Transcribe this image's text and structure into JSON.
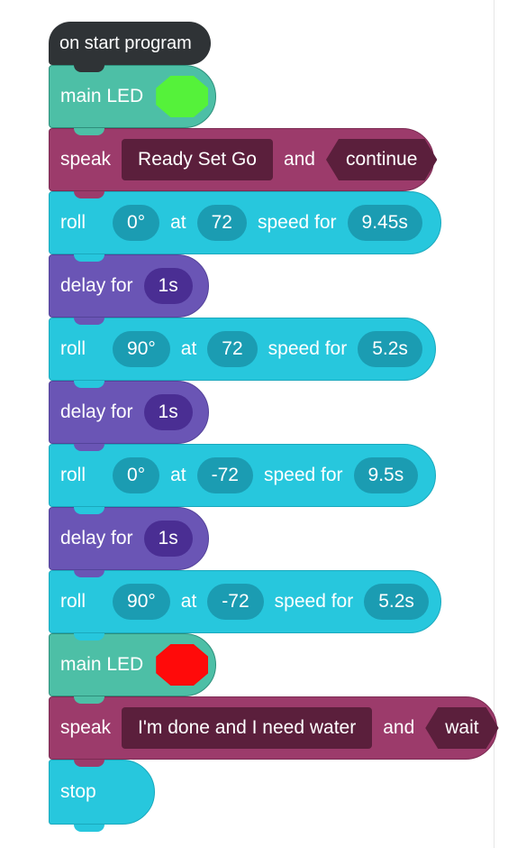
{
  "program": {
    "start_label": "on start program",
    "led1": {
      "label": "main LED",
      "color": "#55f23a"
    },
    "speak1": {
      "label": "speak",
      "text": "Ready Set Go",
      "and_label": "and",
      "mode": "continue"
    },
    "roll1": {
      "label": "roll",
      "heading": "0°",
      "at_label": "at",
      "speed": "72",
      "speed_label": "speed for",
      "duration": "9.45s"
    },
    "delay1": {
      "label": "delay for",
      "duration": "1s"
    },
    "roll2": {
      "label": "roll",
      "heading": "90°",
      "at_label": "at",
      "speed": "72",
      "speed_label": "speed for",
      "duration": "5.2s"
    },
    "delay2": {
      "label": "delay for",
      "duration": "1s"
    },
    "roll3": {
      "label": "roll",
      "heading": "0°",
      "at_label": "at",
      "speed": "-72",
      "speed_label": "speed for",
      "duration": "9.5s"
    },
    "delay3": {
      "label": "delay for",
      "duration": "1s"
    },
    "roll4": {
      "label": "roll",
      "heading": "90°",
      "at_label": "at",
      "speed": "-72",
      "speed_label": "speed for",
      "duration": "5.2s"
    },
    "led2": {
      "label": "main LED",
      "color": "#ff0a0a"
    },
    "speak2": {
      "label": "speak",
      "text": "I'm done and I need water",
      "and_label": "and",
      "mode": "wait"
    },
    "stop_label": "stop"
  }
}
